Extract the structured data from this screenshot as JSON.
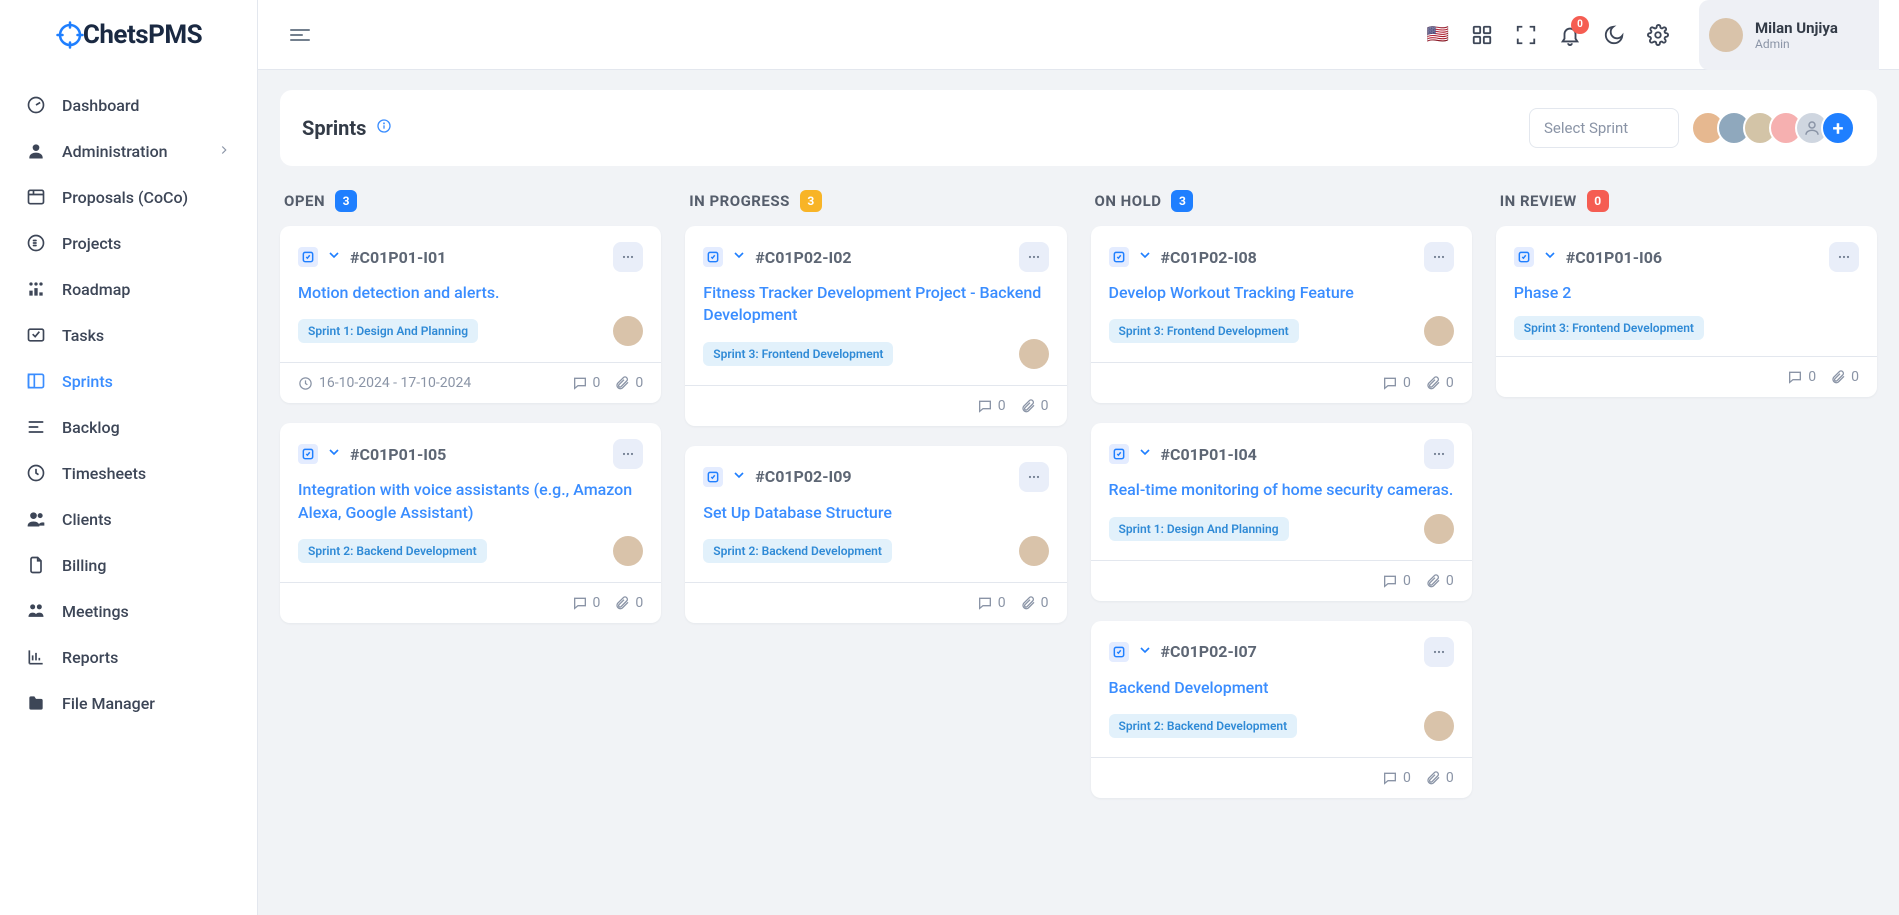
{
  "brand": "ChetsPMS",
  "user": {
    "name": "Milan Unjiya",
    "role": "Admin"
  },
  "nav": [
    {
      "label": "Dashboard"
    },
    {
      "label": "Administration",
      "expandable": true
    },
    {
      "label": "Proposals (CoCo)"
    },
    {
      "label": "Projects"
    },
    {
      "label": "Roadmap"
    },
    {
      "label": "Tasks"
    },
    {
      "label": "Sprints",
      "active": true
    },
    {
      "label": "Backlog"
    },
    {
      "label": "Timesheets"
    },
    {
      "label": "Clients"
    },
    {
      "label": "Billing"
    },
    {
      "label": "Meetings"
    },
    {
      "label": "Reports"
    },
    {
      "label": "File Manager"
    }
  ],
  "notifications_count": "0",
  "page": {
    "title": "Sprints",
    "select_placeholder": "Select Sprint"
  },
  "columns": [
    {
      "title": "OPEN",
      "count": "3",
      "pill": "blue"
    },
    {
      "title": "IN PROGRESS",
      "count": "3",
      "pill": "orange"
    },
    {
      "title": "ON HOLD",
      "count": "3",
      "pill": "blue"
    },
    {
      "title": "IN REVIEW",
      "count": "0",
      "pill": "red"
    }
  ],
  "cards": {
    "open": [
      {
        "id": "#C01P01-I01",
        "title": "Motion detection and alerts.",
        "sprint": "Sprint 1: Design And Planning",
        "date": "16-10-2024 - 17-10-2024",
        "comments": "0",
        "attach": "0",
        "has_date": true
      },
      {
        "id": "#C01P01-I05",
        "title": "Integration with voice assistants (e.g., Amazon Alexa, Google Assistant)",
        "sprint": "Sprint 2: Backend Development",
        "comments": "0",
        "attach": "0",
        "has_date": false
      }
    ],
    "progress": [
      {
        "id": "#C01P02-I02",
        "title": "Fitness Tracker Development Project - Backend Development",
        "sprint": "Sprint 3: Frontend Development",
        "comments": "0",
        "attach": "0",
        "has_date": false
      },
      {
        "id": "#C01P02-I09",
        "title": "Set Up Database Structure",
        "sprint": "Sprint 2: Backend Development",
        "comments": "0",
        "attach": "0",
        "has_date": false
      }
    ],
    "hold": [
      {
        "id": "#C01P02-I08",
        "title": "Develop Workout Tracking Feature",
        "sprint": "Sprint 3: Frontend Development",
        "comments": "0",
        "attach": "0",
        "has_date": false
      },
      {
        "id": "#C01P01-I04",
        "title": "Real-time monitoring of home security cameras.",
        "sprint": "Sprint 1: Design And Planning",
        "comments": "0",
        "attach": "0",
        "has_date": false
      },
      {
        "id": "#C01P02-I07",
        "title": "Backend Development",
        "sprint": "Sprint 2: Backend Development",
        "comments": "0",
        "attach": "0",
        "has_date": false
      }
    ],
    "review": [
      {
        "id": "#C01P01-I06",
        "title": "Phase 2",
        "sprint": "Sprint 3: Frontend Development",
        "comments": "0",
        "attach": "0",
        "has_date": false,
        "no_avatar": true
      }
    ]
  }
}
